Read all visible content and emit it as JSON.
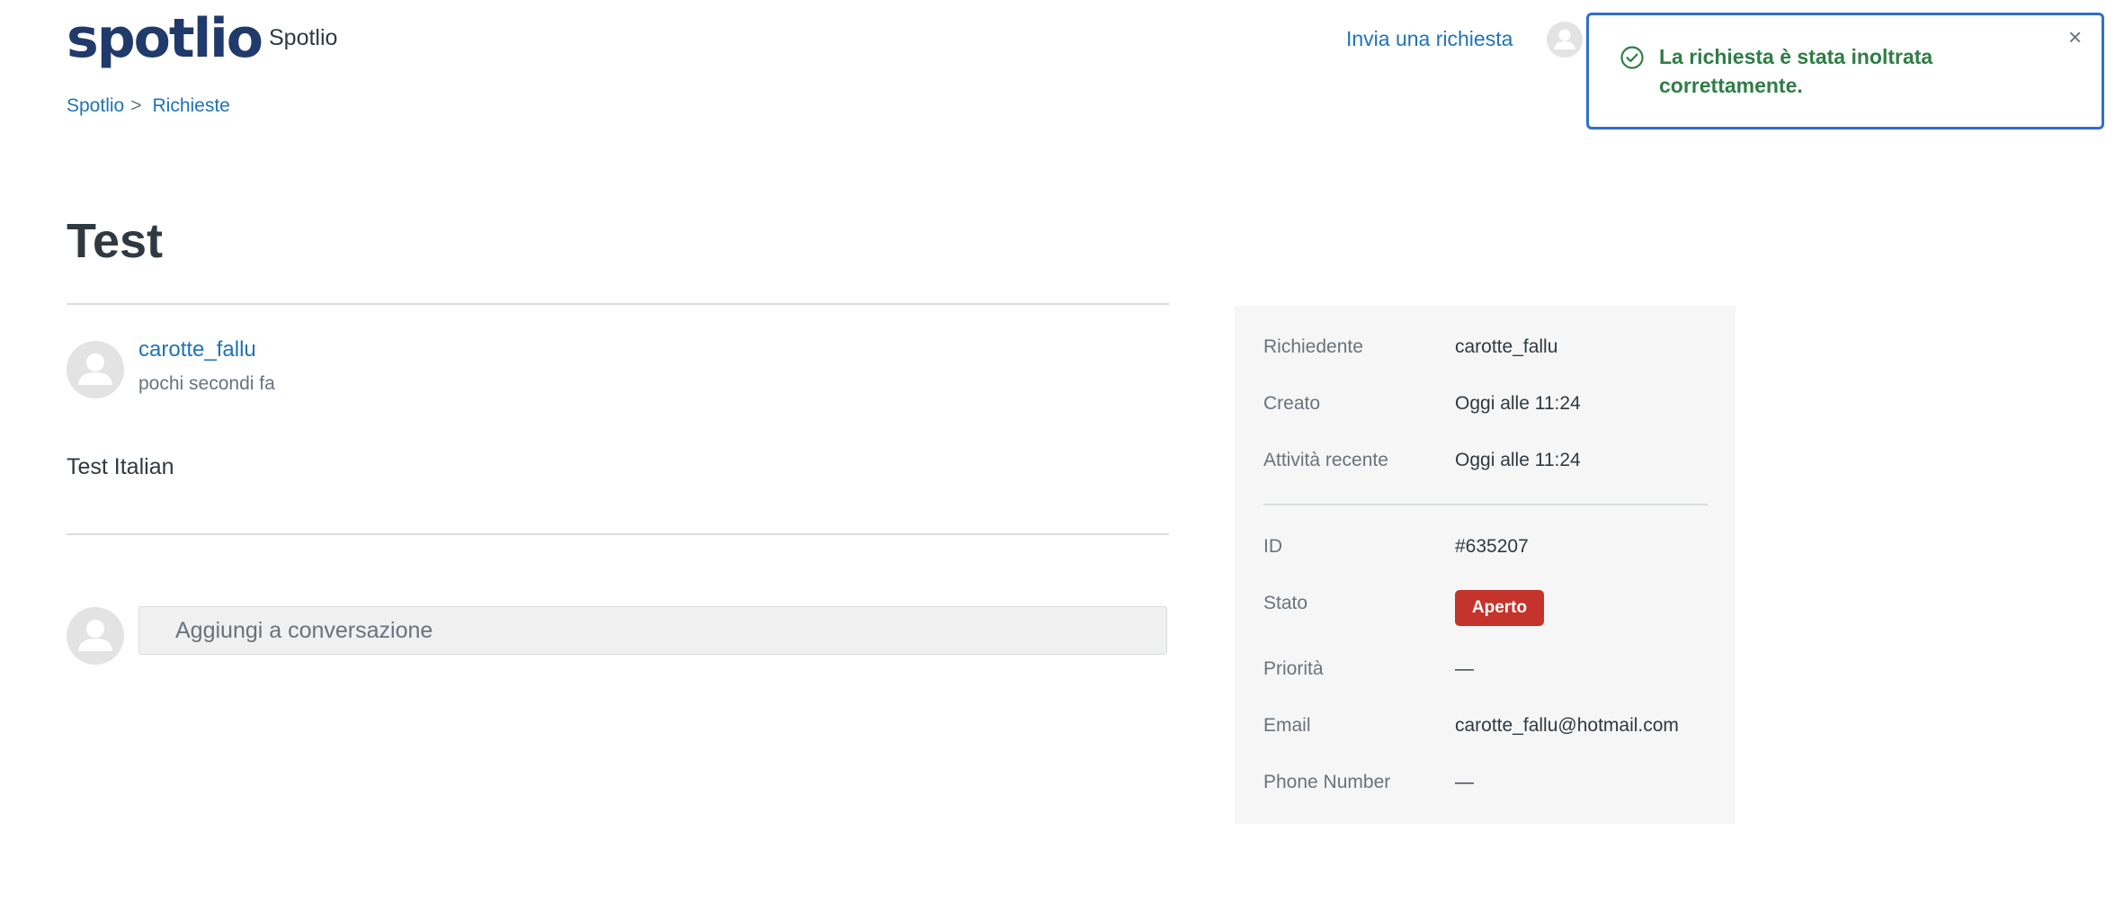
{
  "header": {
    "logo_text": "spotlio",
    "brand_name": "Spotlio",
    "submit_request_label": "Invia una richiesta"
  },
  "breadcrumb": {
    "items": [
      "Spotlio",
      "Richieste"
    ],
    "separator": ">"
  },
  "request": {
    "title": "Test",
    "comment": {
      "author": "carotte_fallu",
      "time": "pochi secondi fa",
      "body": "Test Italian"
    },
    "reply_placeholder": "Aggiungi a conversazione"
  },
  "details": {
    "requester_label": "Richiedente",
    "requester_value": "carotte_fallu",
    "created_label": "Creato",
    "created_value": "Oggi alle 11:24",
    "activity_label": "Attività recente",
    "activity_value": "Oggi alle 11:24",
    "id_label": "ID",
    "id_value": "#635207",
    "status_label": "Stato",
    "status_value": "Aperto",
    "priority_label": "Priorità",
    "priority_value": "—",
    "email_label": "Email",
    "email_value": "carotte_fallu@hotmail.com",
    "phone_label": "Phone Number",
    "phone_value": "—"
  },
  "toast": {
    "message": "La richiesta è stata inoltrata correttamente.",
    "close_symbol": "×"
  },
  "colors": {
    "link": "#1f73b7",
    "status_open": "#c4332c",
    "success": "#2f7d46",
    "toast_border": "#2f6fd0",
    "logo": "#1f3a6b",
    "logo_dot": "#7b5ea7"
  }
}
